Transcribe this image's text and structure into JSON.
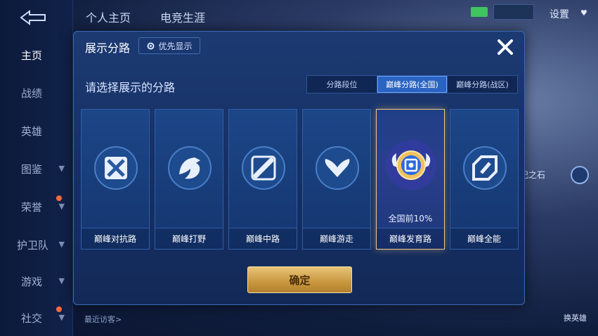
{
  "left_nav": {
    "items": [
      {
        "label": "主页",
        "active": true
      },
      {
        "label": "战绩"
      },
      {
        "label": "英雄"
      },
      {
        "label": "图鉴"
      },
      {
        "label": "荣誉"
      },
      {
        "label": "护卫队"
      },
      {
        "label": "游戏"
      },
      {
        "label": "社交"
      }
    ]
  },
  "top_bar": {
    "tabs": [
      "个人主页",
      "电竞生涯"
    ],
    "settings": "设置"
  },
  "background": {
    "recent_visitors": "最近访客>",
    "right_label": "记之石",
    "swap_hero": "换英雄"
  },
  "modal": {
    "title": "展示分路",
    "priority_button": "优先显示",
    "subtitle": "请选择展示的分路",
    "seg_tabs": [
      {
        "label": "分路段位"
      },
      {
        "label": "巅峰分路(全国)",
        "active": true
      },
      {
        "label": "巅峰分路(战区)"
      }
    ],
    "cards": [
      {
        "label": "巅峰对抗路",
        "icon": "clash-lane-icon"
      },
      {
        "label": "巅峰打野",
        "icon": "jungle-dragon-icon"
      },
      {
        "label": "巅峰中路",
        "icon": "mid-lane-icon"
      },
      {
        "label": "巅峰游走",
        "icon": "roam-wings-icon"
      },
      {
        "label": "巅峰发育路",
        "icon": "farm-lane-icon",
        "selected": true,
        "rank": "全国前10%"
      },
      {
        "label": "巅峰全能",
        "icon": "allround-icon"
      }
    ],
    "confirm": "确定"
  },
  "colors": {
    "accent_blue": "#2a63c2",
    "gold": "#c8973e",
    "selected_border": "#f2c98a"
  }
}
